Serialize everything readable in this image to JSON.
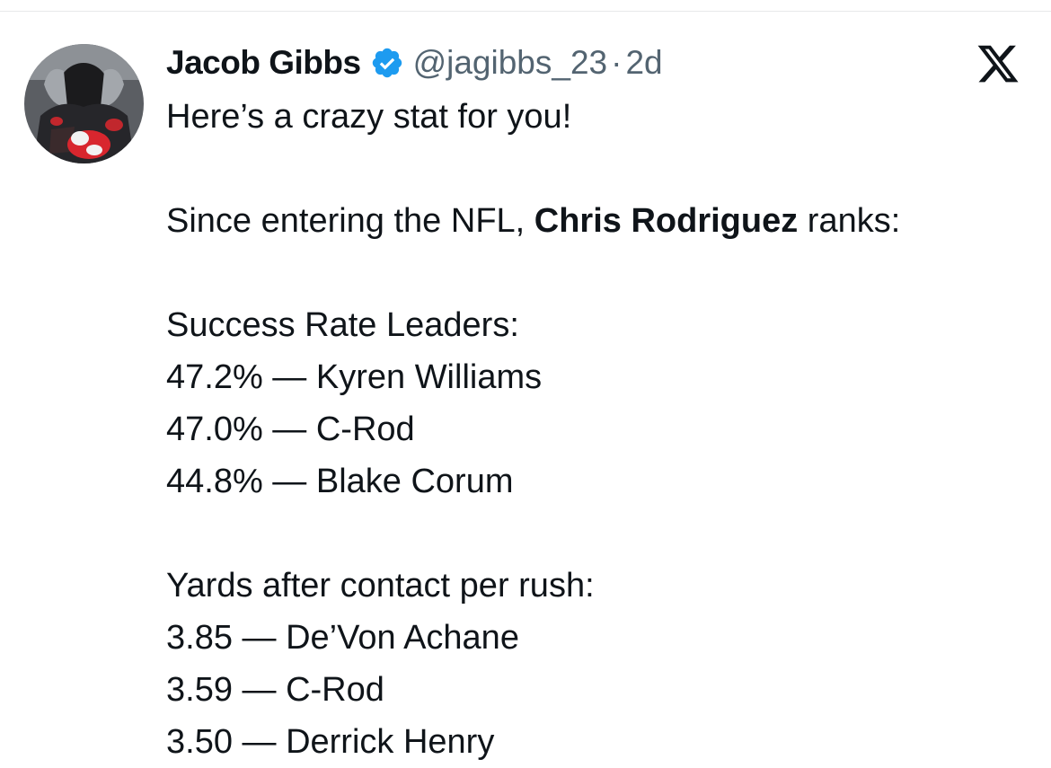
{
  "tweet": {
    "author_name": "Jacob Gibbs",
    "handle": "@jagibbs_23",
    "separator": "·",
    "age": "2d",
    "verified_icon": "verified-badge-icon",
    "platform_icon": "x-logo-icon",
    "colors": {
      "verified": "#1d9bf0",
      "handle": "#536471",
      "text": "#0f1419"
    },
    "intro": "Here’s a crazy stat for you!",
    "sentence_prefix": "Since entering the NFL, ",
    "player_name": "Chris Rodriguez",
    "sentence_suffix": " ranks:",
    "sections": [
      {
        "heading": "Success Rate Leaders:",
        "rows": [
          "47.2% — Kyren Williams",
          "47.0% — C-Rod",
          "44.8% — Blake Corum"
        ]
      },
      {
        "heading": "Yards after contact per rush:",
        "rows": [
          "3.85 — De’Von Achane",
          "3.59 — C-Rod",
          "3.50 — Derrick Henry"
        ]
      }
    ]
  }
}
